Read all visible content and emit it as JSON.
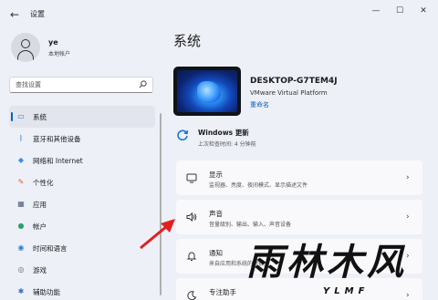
{
  "window": {
    "title": "设置",
    "back_glyph": "←",
    "min_glyph": "—",
    "max_glyph": "☐",
    "close_glyph": "✕"
  },
  "profile": {
    "name": "ye",
    "account_type": "本地帐户"
  },
  "search": {
    "placeholder": "查找设置"
  },
  "sidebar": {
    "items": [
      {
        "label": "系统",
        "icon": "monitor-icon",
        "glyph": "▭",
        "color": "#2b6fd6",
        "active": true
      },
      {
        "label": "蓝牙和其他设备",
        "icon": "bluetooth-icon",
        "glyph": "ᛒ",
        "color": "#1a73d9",
        "active": false
      },
      {
        "label": "网络和 Internet",
        "icon": "wifi-icon",
        "glyph": "◆",
        "color": "#3a8ee6",
        "active": false
      },
      {
        "label": "个性化",
        "icon": "brush-icon",
        "glyph": "✎",
        "color": "#c86a2b",
        "active": false
      },
      {
        "label": "应用",
        "icon": "apps-icon",
        "glyph": "▦",
        "color": "#4a5a78",
        "active": false
      },
      {
        "label": "帐户",
        "icon": "person-icon",
        "glyph": "●",
        "color": "#2aa36b",
        "active": false
      },
      {
        "label": "时间和语言",
        "icon": "globe-icon",
        "glyph": "◉",
        "color": "#2b7fd6",
        "active": false
      },
      {
        "label": "游戏",
        "icon": "gamepad-icon",
        "glyph": "◎",
        "color": "#666a74",
        "active": false
      },
      {
        "label": "辅助功能",
        "icon": "accessibility-icon",
        "glyph": "✱",
        "color": "#2d6fd0",
        "active": false
      }
    ]
  },
  "main": {
    "title": "系统",
    "device": {
      "name": "DESKTOP-G7TEM4J",
      "model": "VMware Virtual Platform",
      "rename_label": "重命名"
    },
    "update": {
      "title": "Windows 更新",
      "subtitle": "上次检查时间: 4 分钟前"
    },
    "cards": [
      {
        "icon": "display-icon",
        "title": "显示",
        "subtitle": "监视器、亮度、夜间模式、显示描述文件"
      },
      {
        "icon": "speaker-icon",
        "title": "声音",
        "subtitle": "音量级别、输出、输入、声音设备"
      },
      {
        "icon": "bell-icon",
        "title": "通知",
        "subtitle": "来自应用和系统的警报"
      },
      {
        "icon": "moon-icon",
        "title": "专注助手",
        "subtitle": ""
      }
    ],
    "chevron_glyph": "›"
  },
  "watermark": {
    "text": "雨林木风",
    "sub": "YLMF"
  },
  "colors": {
    "accent": "#005fb8",
    "arrow": "#e02020",
    "background": "#eef0f8",
    "card": "#f9f9fb"
  }
}
